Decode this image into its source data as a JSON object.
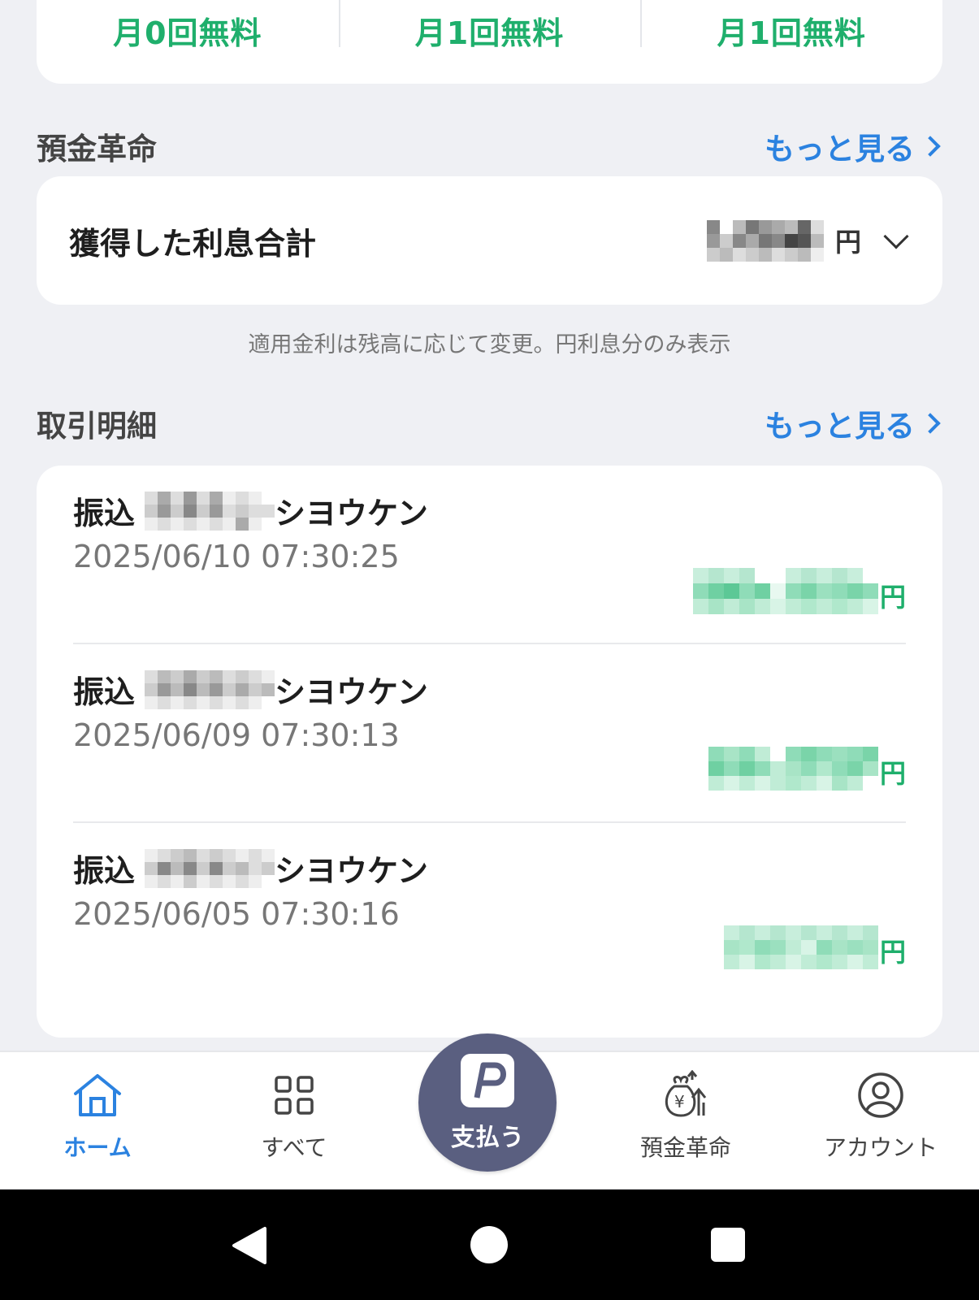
{
  "top_card": {
    "cells": [
      {
        "free_label": "月0回無料"
      },
      {
        "free_label": "月1回無料"
      },
      {
        "free_label": "月1回無料"
      }
    ]
  },
  "deposit": {
    "title": "預金革命",
    "more_label": "もっと見る",
    "interest_label": "獲得した利息合計",
    "interest_unit": "円",
    "note": "適用金利は残高に応じて変更。円利息分のみ表示"
  },
  "transactions": {
    "title": "取引明細",
    "more_label": "もっと見る",
    "items": [
      {
        "type": "振込",
        "name_suffix": "シヨウケン",
        "datetime": "2025/06/10 07:30:25",
        "unit": "円"
      },
      {
        "type": "振込",
        "name_suffix": "シヨウケン",
        "datetime": "2025/06/09 07:30:13",
        "unit": "円"
      },
      {
        "type": "振込",
        "name_suffix": "シヨウケン",
        "datetime": "2025/06/05 07:30:16",
        "unit": "円"
      }
    ]
  },
  "bottom_nav": {
    "home": "ホーム",
    "all": "すべて",
    "pay": "支払う",
    "deposit": "預金革命",
    "account": "アカウント"
  },
  "colors": {
    "accent_blue": "#2b82e0",
    "green": "#1faf6c",
    "pay_button": "#5a5f80",
    "background": "#eff0f4"
  },
  "icons": {
    "home": "home-icon",
    "all": "grid-icon",
    "pay": "paypay-logo-icon",
    "deposit": "money-bag-icon",
    "account": "user-circle-icon"
  }
}
